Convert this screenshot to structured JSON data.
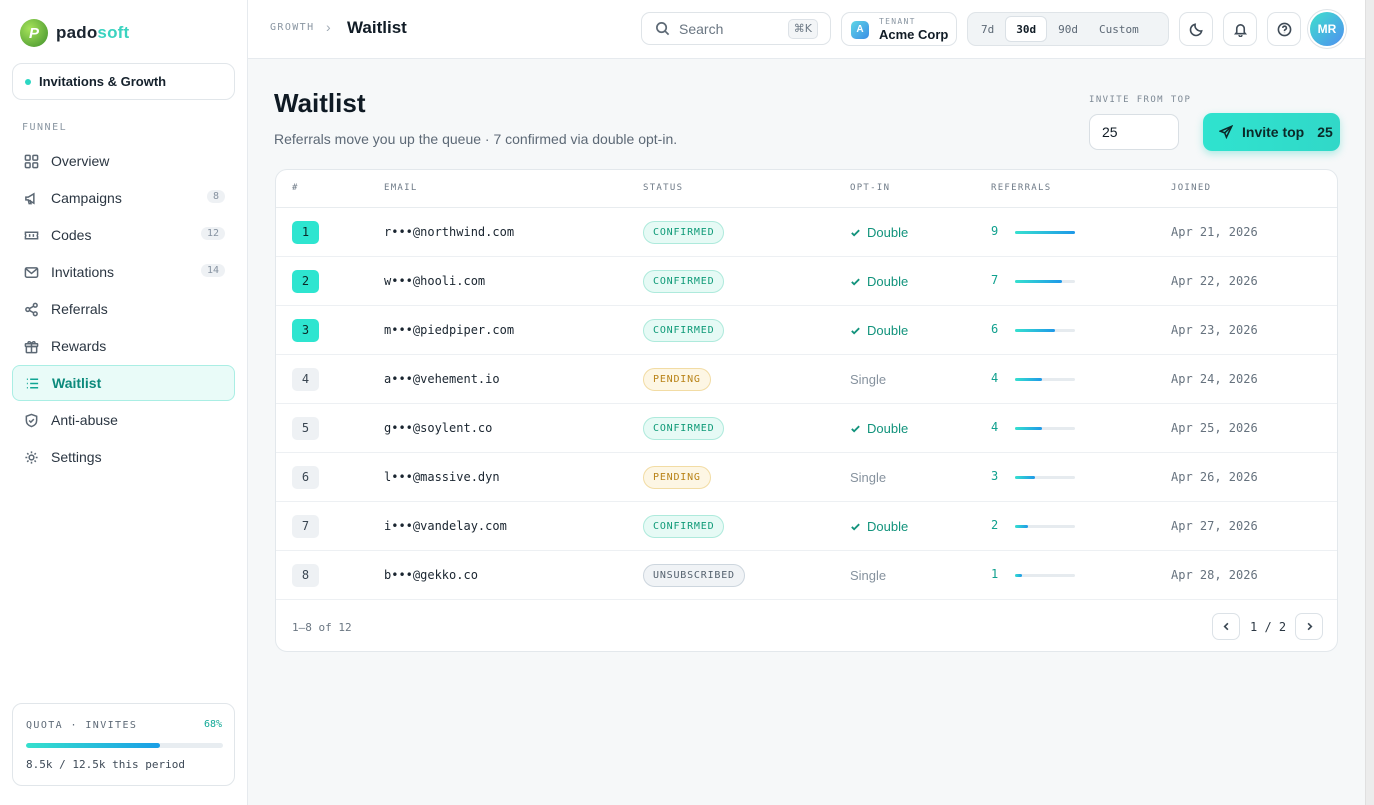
{
  "brand": {
    "part1": "pado",
    "part2": "soft",
    "logo_letter": "P"
  },
  "workspace": {
    "label": "Invitations & Growth"
  },
  "sidebar": {
    "section_label": "FUNNEL",
    "items": [
      {
        "label": "Overview",
        "icon": "grid-icon",
        "count": ""
      },
      {
        "label": "Campaigns",
        "icon": "megaphone-icon",
        "count": "8"
      },
      {
        "label": "Codes",
        "icon": "ticket-icon",
        "count": "12"
      },
      {
        "label": "Invitations",
        "icon": "mail-icon",
        "count": "14"
      },
      {
        "label": "Referrals",
        "icon": "share-icon",
        "count": ""
      },
      {
        "label": "Rewards",
        "icon": "gift-icon",
        "count": ""
      },
      {
        "label": "Waitlist",
        "icon": "list-icon",
        "count": "",
        "active": true
      },
      {
        "label": "Anti-abuse",
        "icon": "shield-icon",
        "count": ""
      },
      {
        "label": "Settings",
        "icon": "gear-icon",
        "count": ""
      }
    ]
  },
  "quota": {
    "label": "QUOTA · INVITES",
    "percent_label": "68%",
    "fraction": 0.68,
    "text": "8.5k / 12.5k this period"
  },
  "header": {
    "breadcrumb_parent": "GROWTH",
    "breadcrumb_current": "Waitlist",
    "search_placeholder": "Search",
    "search_shortcut": "⌘K",
    "tenant_label": "TENANT",
    "tenant_name": "Acme Corp",
    "tenant_initial": "A",
    "ranges": [
      "7d",
      "30d",
      "90d",
      "Custom"
    ],
    "active_range": "30d",
    "user_initials": "MR"
  },
  "page": {
    "title": "Waitlist",
    "subtitle": "Referrals move you up the queue · 7 confirmed via double opt-in.",
    "invite_label": "INVITE FROM TOP",
    "invite_value": "25",
    "invite_button_label": "Invite top",
    "invite_button_count": "25"
  },
  "table": {
    "columns": [
      "#",
      "EMAIL",
      "STATUS",
      "OPT-IN",
      "REFERRALS",
      "JOINED"
    ],
    "rows": [
      {
        "rank": "1",
        "email": "r•••@northwind.com",
        "status": "CONFIRMED",
        "optin": "Double",
        "referrals": "9",
        "joined": "Apr 21, 2026"
      },
      {
        "rank": "2",
        "email": "w•••@hooli.com",
        "status": "CONFIRMED",
        "optin": "Double",
        "referrals": "7",
        "joined": "Apr 22, 2026"
      },
      {
        "rank": "3",
        "email": "m•••@piedpiper.com",
        "status": "CONFIRMED",
        "optin": "Double",
        "referrals": "6",
        "joined": "Apr 23, 2026"
      },
      {
        "rank": "4",
        "email": "a•••@vehement.io",
        "status": "PENDING",
        "optin": "Single",
        "referrals": "4",
        "joined": "Apr 24, 2026"
      },
      {
        "rank": "5",
        "email": "g•••@soylent.co",
        "status": "CONFIRMED",
        "optin": "Double",
        "referrals": "4",
        "joined": "Apr 25, 2026"
      },
      {
        "rank": "6",
        "email": "l•••@massive.dyn",
        "status": "PENDING",
        "optin": "Single",
        "referrals": "3",
        "joined": "Apr 26, 2026"
      },
      {
        "rank": "7",
        "email": "i•••@vandelay.com",
        "status": "CONFIRMED",
        "optin": "Double",
        "referrals": "2",
        "joined": "Apr 27, 2026"
      },
      {
        "rank": "8",
        "email": "b•••@gekko.co",
        "status": "UNSUBSCRIBED",
        "optin": "Single",
        "referrals": "1",
        "joined": "Apr 28, 2026"
      }
    ],
    "footer_count": "1–8 of 12",
    "page_indicator": "1 / 2"
  },
  "colors": {
    "accent": "#2ee5d0",
    "accent_text": "#10a08e",
    "confirmed": "#0e9a77",
    "pending": "#b98318"
  }
}
